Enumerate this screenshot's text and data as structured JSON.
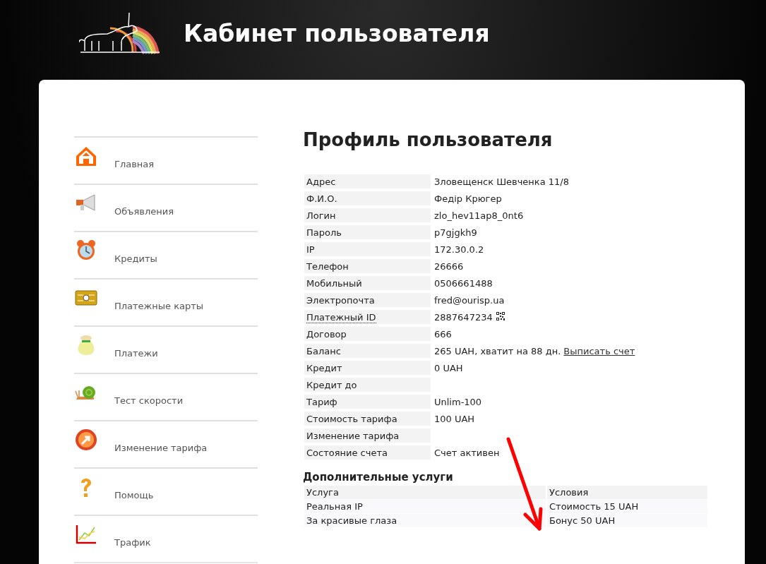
{
  "header": {
    "title": "Кабинет пользователя"
  },
  "sidebar": {
    "items": [
      {
        "label": "Главная",
        "kind": "home"
      },
      {
        "label": "Объявления",
        "kind": "megaphone"
      },
      {
        "label": "Кредиты",
        "kind": "clock"
      },
      {
        "label": "Платежные карты",
        "kind": "card"
      },
      {
        "label": "Платежи",
        "kind": "bag"
      },
      {
        "label": "Тест скорости",
        "kind": "snail"
      },
      {
        "label": "Изменение тарифа",
        "kind": "swap"
      },
      {
        "label": "Помощь",
        "kind": "help"
      },
      {
        "label": "Трафик",
        "kind": "chart"
      }
    ]
  },
  "profile": {
    "title": "Профиль пользователя",
    "rows": [
      {
        "label": "Адрес",
        "value": "Зловещенск Шевченка 11/8"
      },
      {
        "label": "Ф.И.О.",
        "value": "Федір Крюгер"
      },
      {
        "label": "Логин",
        "value": "zlo_hev11ap8_0nt6"
      },
      {
        "label": "Пароль",
        "value": "p7gjgkh9"
      },
      {
        "label": "IP",
        "value": "172.30.0.2"
      },
      {
        "label": "Телефон",
        "value": "26666"
      },
      {
        "label": "Мобильный",
        "value": "0506661488"
      },
      {
        "label": "Электропочта",
        "value": "fred@ourisp.ua"
      },
      {
        "label": "Платежный ID",
        "dotted": true,
        "value": "2887647234",
        "qr": true
      },
      {
        "label": "Договор",
        "value": "666"
      },
      {
        "label": "Баланс",
        "value": "265 UAH, хватит на 88 дн.",
        "link": "Выписать счет"
      },
      {
        "label": "Кредит",
        "value": "0 UAH"
      },
      {
        "label": "Кредит до"
      },
      {
        "label": "Тариф",
        "value": "Unlim-100"
      },
      {
        "label": "Стоимость тарифа",
        "value": "100 UAH"
      },
      {
        "label": "Изменение тарифа"
      },
      {
        "label": "Состояние счета",
        "value": "Счет активен"
      }
    ]
  },
  "services": {
    "title": "Дополнительные услуги",
    "columns": [
      "Услуга",
      "Условия"
    ],
    "rows": [
      [
        "Реальная IP",
        "Стоимость 15 UAH"
      ],
      [
        "За красивые глаза",
        "Бонус 50 UAH"
      ]
    ]
  }
}
